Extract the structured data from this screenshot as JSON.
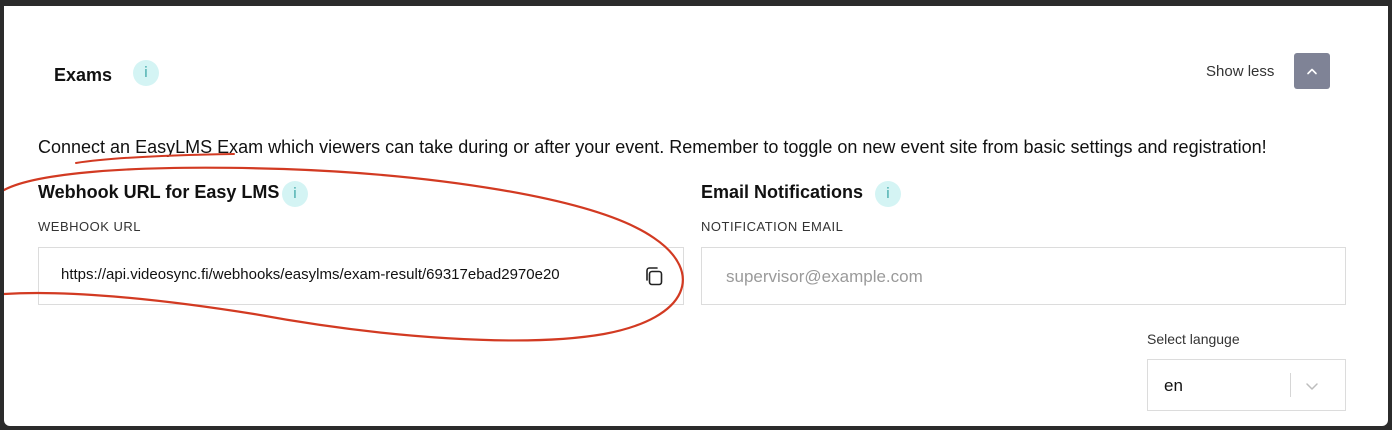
{
  "header": {
    "title": "Exams",
    "info_glyph": "i",
    "show_less_label": "Show less",
    "collapse_icon": "chevron-up-icon"
  },
  "description": "Connect an EasyLMS Exam which viewers can take during or after your event. Remember to toggle on new event site from basic settings and registration!",
  "webhook": {
    "title": "Webhook URL for Easy LMS",
    "info_glyph": "i",
    "field_label": "WEBHOOK URL",
    "value": "https://api.videosync.fi/webhooks/easylms/exam-result/69317ebad2970e20",
    "copy_icon": "copy-icon"
  },
  "email": {
    "title": "Email Notifications",
    "info_glyph": "i",
    "field_label": "NOTIFICATION EMAIL",
    "placeholder": "supervisor@example.com",
    "value": ""
  },
  "language": {
    "label": "Select languge",
    "selected": "en",
    "dropdown_icon": "chevron-down-icon"
  },
  "colors": {
    "info_badge_bg": "#d4f4f4",
    "info_badge_text": "#3aa7a7",
    "collapse_button_bg": "#7f8396",
    "annotation_red": "#d23a22"
  }
}
